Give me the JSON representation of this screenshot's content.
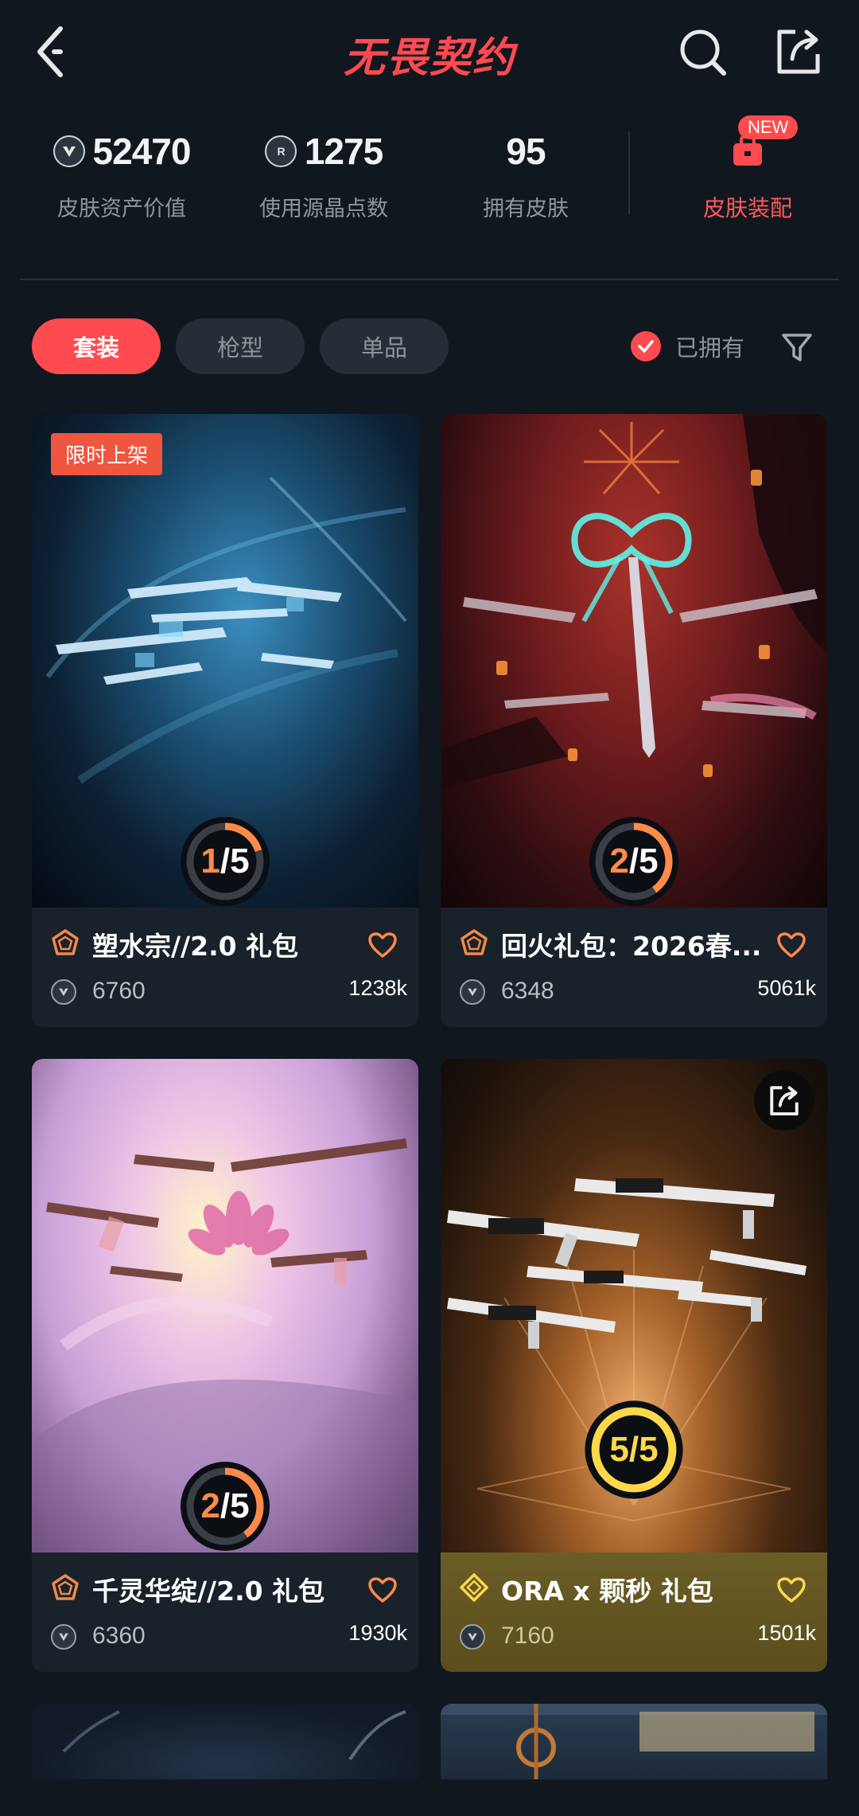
{
  "header": {
    "logo_text": "无畏契约",
    "back_icon": "chevron-left-icon",
    "search_icon": "search-icon",
    "share_icon": "share-icon"
  },
  "stats": [
    {
      "value": "52470",
      "label": "皮肤资产价值",
      "icon": "vp-coin-icon"
    },
    {
      "value": "1275",
      "label": "使用源晶点数",
      "icon": "radianite-icon"
    },
    {
      "value": "95",
      "label": "拥有皮肤"
    }
  ],
  "equip": {
    "label": "皮肤装配",
    "badge": "NEW",
    "icon": "locker-icon"
  },
  "filters": {
    "tabs": [
      {
        "label": "套装",
        "active": true
      },
      {
        "label": "枪型",
        "active": false
      },
      {
        "label": "单品",
        "active": false
      }
    ],
    "owned_label": "已拥有",
    "owned_checked": true
  },
  "cards": [
    {
      "name": "塑水宗//2.0 礼包",
      "price": "6760",
      "likes": "1238k",
      "progress": "1/5",
      "progress_owned": 1,
      "progress_total": 5,
      "badge": "限时上架",
      "theme": "default"
    },
    {
      "name": "回火礼包：2026春...",
      "price": "6348",
      "likes": "5061k",
      "progress": "2/5",
      "progress_owned": 2,
      "progress_total": 5,
      "theme": "default"
    },
    {
      "name": "千灵华绽//2.0 礼包",
      "price": "6360",
      "likes": "1930k",
      "progress": "2/5",
      "progress_owned": 2,
      "progress_total": 5,
      "theme": "default"
    },
    {
      "name": "ORA x 颗秒 礼包",
      "price": "7160",
      "likes": "1501k",
      "progress": "5/5",
      "progress_owned": 5,
      "progress_total": 5,
      "theme": "gold"
    }
  ],
  "colors": {
    "accent": "#ff4a50",
    "progress": "#ff8a4a",
    "gold": "#ffd84a",
    "background": "#10171f"
  }
}
